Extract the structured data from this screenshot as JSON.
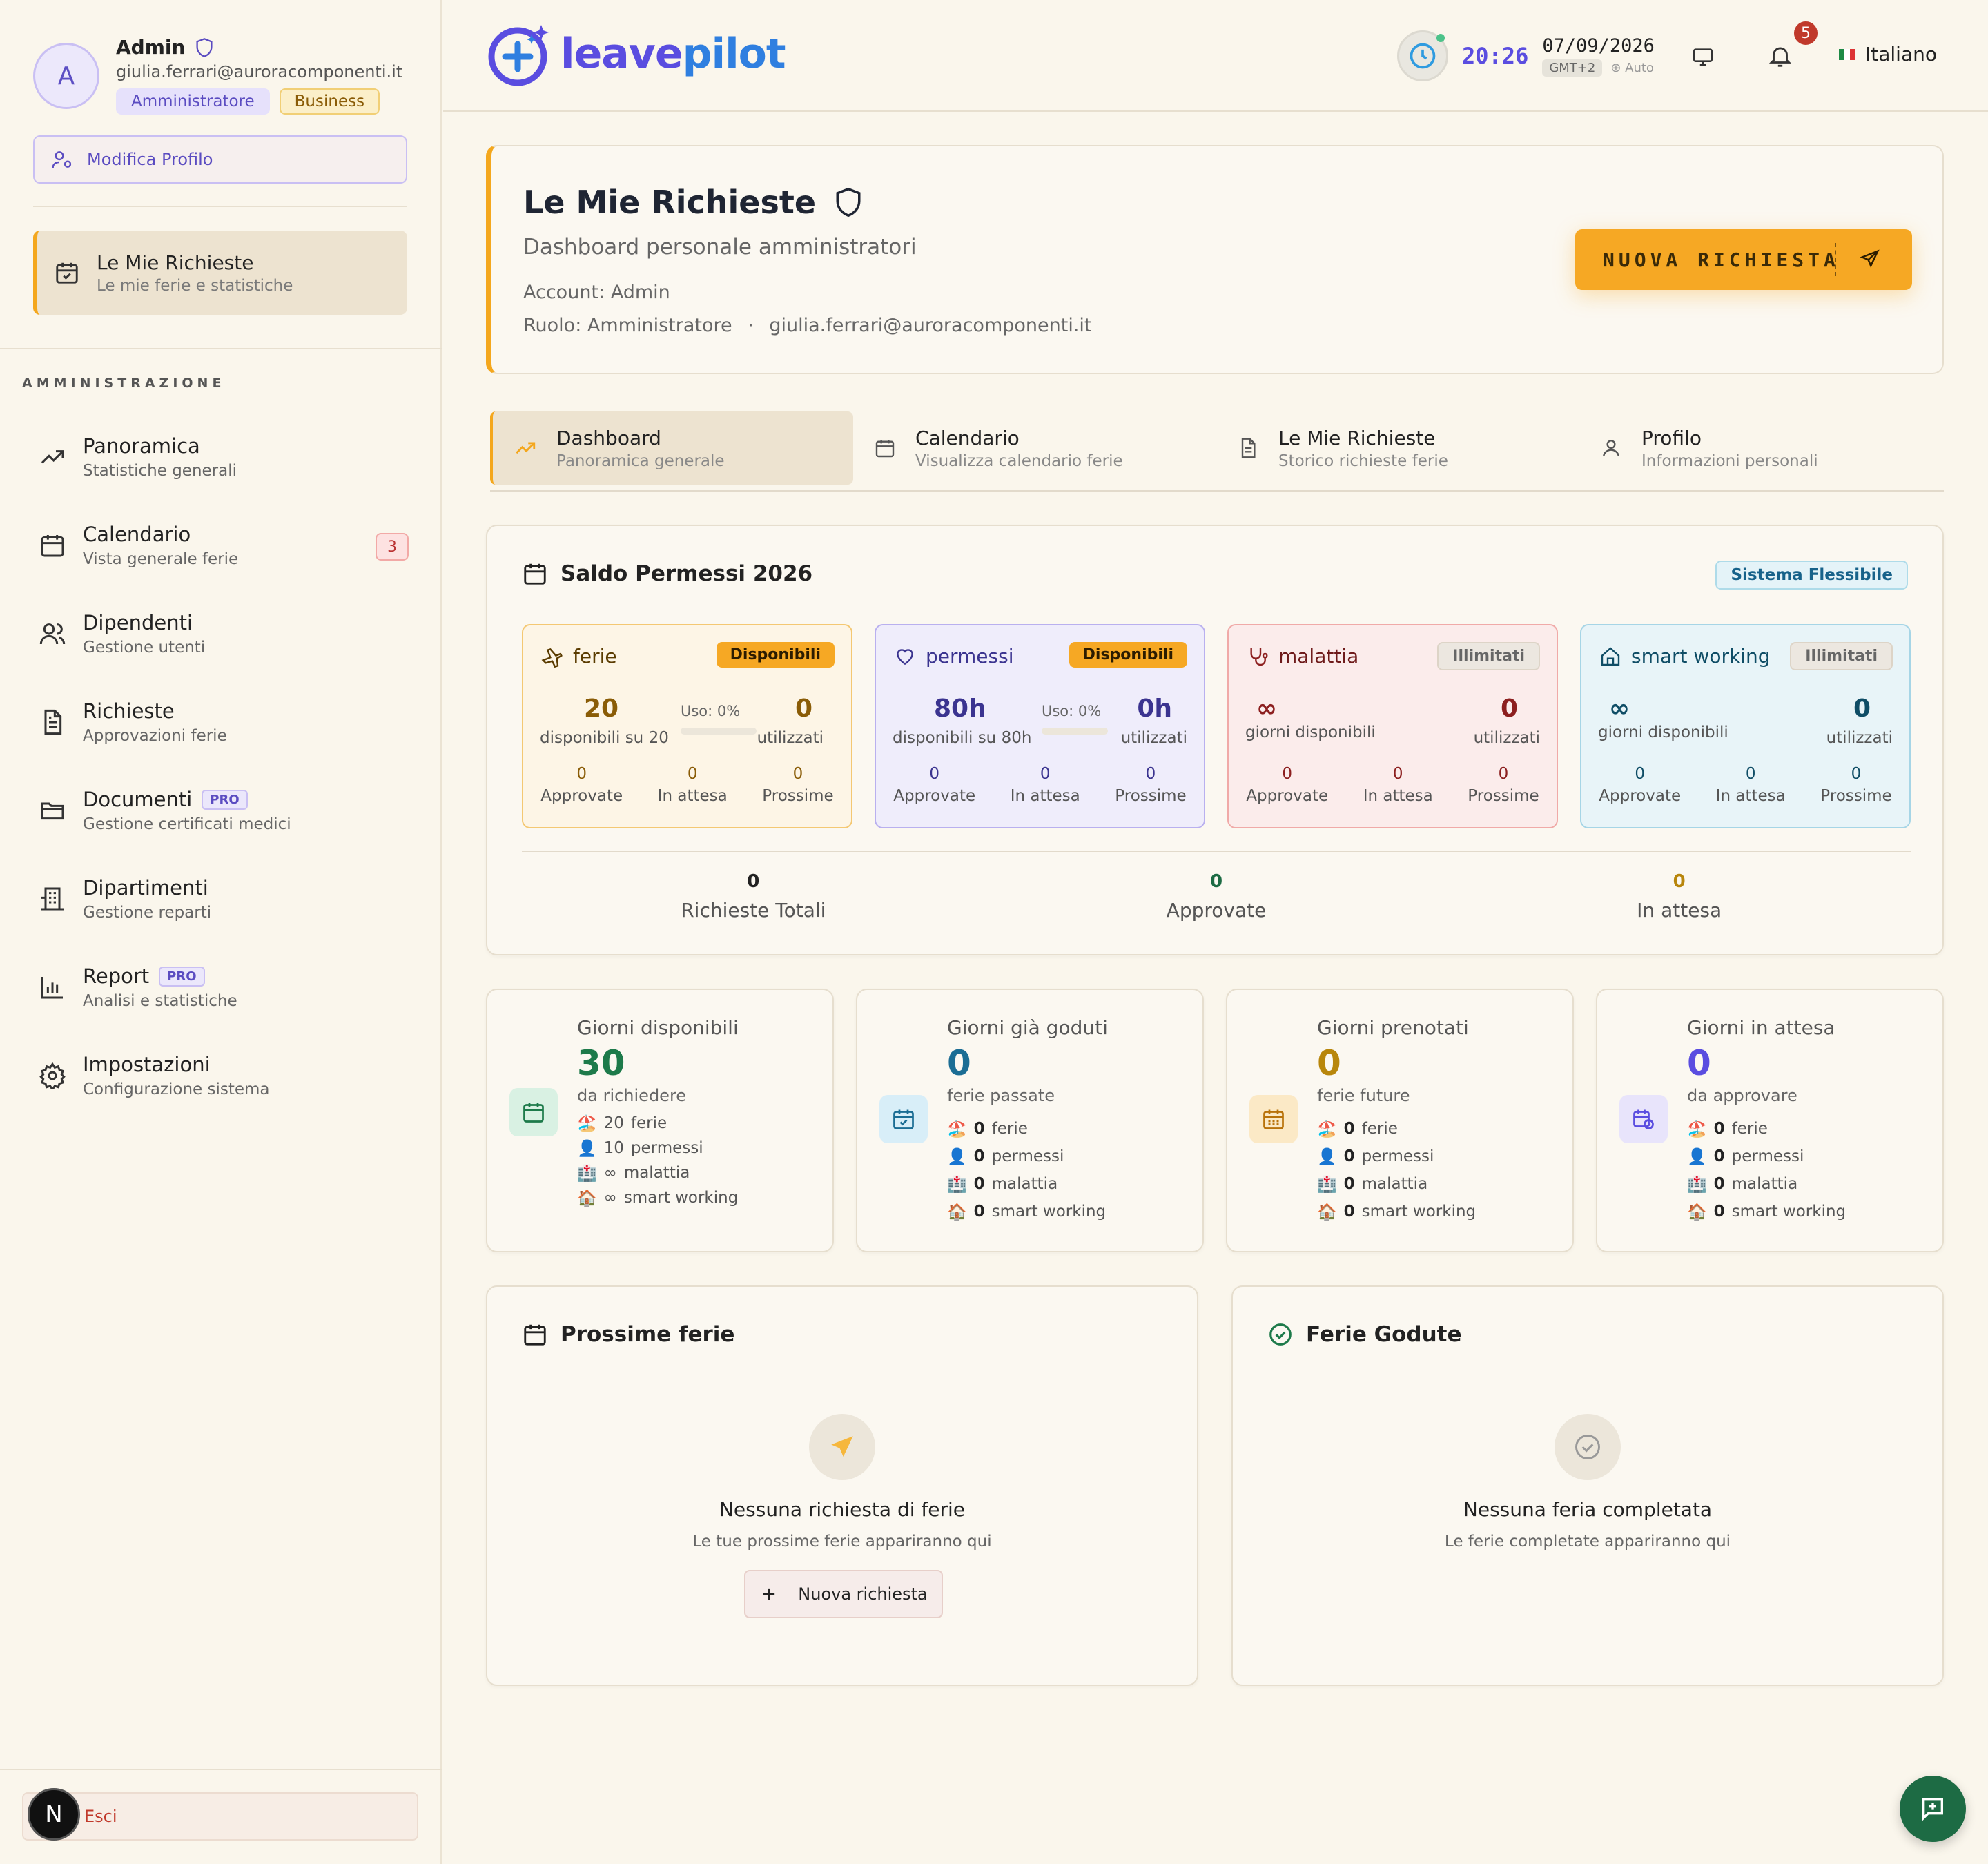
{
  "colors": {
    "accent_orange": "#f6a824",
    "accent_purple": "#5a4de0",
    "ferie": "#8a5c07",
    "permessi": "#3b3490",
    "malattia": "#8c1f1f",
    "smart": "#0f4d66",
    "green": "#1d6b44"
  },
  "sidebar": {
    "profile": {
      "initial": "A",
      "name": "Admin",
      "email": "giulia.ferrari@auroracomponenti.it",
      "role_badge": "Amministratore",
      "plan_badge": "Business"
    },
    "edit_profile_label": "Modifica Profilo",
    "my_requests": {
      "title": "Le Mie Richieste",
      "subtitle": "Le mie ferie e statistiche"
    },
    "section_label": "AMMINISTRAZIONE",
    "nav": [
      {
        "title": "Panoramica",
        "subtitle": "Statistiche generali",
        "icon": "trend-icon"
      },
      {
        "title": "Calendario",
        "subtitle": "Vista generale ferie",
        "icon": "calendar-icon",
        "count": "3"
      },
      {
        "title": "Dipendenti",
        "subtitle": "Gestione utenti",
        "icon": "users-icon"
      },
      {
        "title": "Richieste",
        "subtitle": "Approvazioni ferie",
        "icon": "document-icon"
      },
      {
        "title": "Documenti",
        "subtitle": "Gestione certificati medici",
        "icon": "folder-icon",
        "pro": "PRO"
      },
      {
        "title": "Dipartimenti",
        "subtitle": "Gestione reparti",
        "icon": "building-icon"
      },
      {
        "title": "Report",
        "subtitle": "Analisi e statistiche",
        "icon": "bar-chart-icon",
        "pro": "PRO"
      },
      {
        "title": "Impostazioni",
        "subtitle": "Configurazione sistema",
        "icon": "gear-icon"
      }
    ],
    "logout_label": "Esci",
    "n_logo": "N"
  },
  "header": {
    "logo_leave": "leave",
    "logo_pilot": "pilot",
    "time": "20:26",
    "date": "07/09/2026",
    "timezone": "GMT+2",
    "tz_mode": "Auto",
    "notifications": "5",
    "language": "Italiano"
  },
  "hero": {
    "title": "Le Mie Richieste",
    "subtitle": "Dashboard personale amministratori",
    "account": "Account: Admin",
    "role": "Ruolo: Amministratore",
    "dot": "·",
    "email": "giulia.ferrari@auroracomponenti.it",
    "cta": "NUOVA RICHIESTA"
  },
  "tabs": [
    {
      "title": "Dashboard",
      "subtitle": "Panoramica generale"
    },
    {
      "title": "Calendario",
      "subtitle": "Visualizza calendario ferie"
    },
    {
      "title": "Le Mie Richieste",
      "subtitle": "Storico richieste ferie"
    },
    {
      "title": "Profilo",
      "subtitle": "Informazioni personali"
    }
  ],
  "balance": {
    "title": "Saldo Permessi 2026",
    "badge": "Sistema Flessibile",
    "cards": [
      {
        "name": "ferie",
        "pill": "Disponibili",
        "big": "20",
        "big_label": "disponibili su 20",
        "uso": "Uso: 0%",
        "uso_fraction": 0,
        "used": "0",
        "used_label": "utilizzati",
        "stats": [
          {
            "n": "0",
            "l": "Approvate"
          },
          {
            "n": "0",
            "l": "In attesa"
          },
          {
            "n": "0",
            "l": "Prossime"
          }
        ]
      },
      {
        "name": "permessi",
        "pill": "Disponibili",
        "big": "80h",
        "big_label": "disponibili su 80h",
        "uso": "Uso: 0%",
        "uso_fraction": 0,
        "used": "0h",
        "used_label": "utilizzati",
        "stats": [
          {
            "n": "0",
            "l": "Approvate"
          },
          {
            "n": "0",
            "l": "In attesa"
          },
          {
            "n": "0",
            "l": "Prossime"
          }
        ]
      },
      {
        "name": "malattia",
        "pill": "Illimitati",
        "big": "∞",
        "big_label": "giorni disponibili",
        "used": "0",
        "used_label": "utilizzati",
        "stats": [
          {
            "n": "0",
            "l": "Approvate"
          },
          {
            "n": "0",
            "l": "In attesa"
          },
          {
            "n": "0",
            "l": "Prossime"
          }
        ]
      },
      {
        "name": "smart working",
        "pill": "Illimitati",
        "big": "∞",
        "big_label": "giorni disponibili",
        "used": "0",
        "used_label": "utilizzati",
        "stats": [
          {
            "n": "0",
            "l": "Approvate"
          },
          {
            "n": "0",
            "l": "In attesa"
          },
          {
            "n": "0",
            "l": "Prossime"
          }
        ]
      }
    ],
    "totals": [
      {
        "n": "0",
        "l": "Richieste Totali"
      },
      {
        "n": "0",
        "l": "Approvate"
      },
      {
        "n": "0",
        "l": "In attesa"
      }
    ]
  },
  "summary": [
    {
      "title": "Giorni disponibili",
      "num": "30",
      "sub": "da richiedere",
      "items": [
        {
          "emoji": "🏖️",
          "v": "20",
          "t": "ferie"
        },
        {
          "emoji": "👤",
          "v": "10",
          "t": "permessi"
        },
        {
          "emoji": "🏥",
          "v": "∞",
          "t": "malattia"
        },
        {
          "emoji": "🏠",
          "v": "∞",
          "t": "smart working"
        }
      ]
    },
    {
      "title": "Giorni già goduti",
      "num": "0",
      "sub": "ferie passate",
      "items": [
        {
          "emoji": "🏖️",
          "v": "0",
          "t": "ferie"
        },
        {
          "emoji": "👤",
          "v": "0",
          "t": "permessi"
        },
        {
          "emoji": "🏥",
          "v": "0",
          "t": "malattia"
        },
        {
          "emoji": "🏠",
          "v": "0",
          "t": "smart working"
        }
      ]
    },
    {
      "title": "Giorni prenotati",
      "num": "0",
      "sub": "ferie future",
      "items": [
        {
          "emoji": "🏖️",
          "v": "0",
          "t": "ferie"
        },
        {
          "emoji": "👤",
          "v": "0",
          "t": "permessi"
        },
        {
          "emoji": "🏥",
          "v": "0",
          "t": "malattia"
        },
        {
          "emoji": "🏠",
          "v": "0",
          "t": "smart working"
        }
      ]
    },
    {
      "title": "Giorni in attesa",
      "num": "0",
      "sub": "da approvare",
      "items": [
        {
          "emoji": "🏖️",
          "v": "0",
          "t": "ferie"
        },
        {
          "emoji": "👤",
          "v": "0",
          "t": "permessi"
        },
        {
          "emoji": "🏥",
          "v": "0",
          "t": "malattia"
        },
        {
          "emoji": "🏠",
          "v": "0",
          "t": "smart working"
        }
      ]
    }
  ],
  "upcoming": {
    "title": "Prossime ferie",
    "empty": "Nessuna richiesta di ferie",
    "hint": "Le tue prossime ferie appariranno qui",
    "button": "Nuova richiesta"
  },
  "enjoyed": {
    "title": "Ferie Godute",
    "empty": "Nessuna feria completata",
    "hint": "Le ferie completate appariranno qui"
  }
}
